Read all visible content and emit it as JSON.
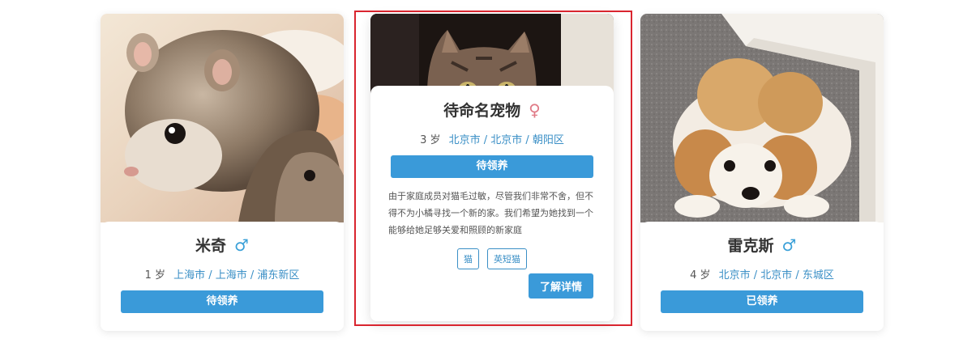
{
  "cards": [
    {
      "name": "米奇",
      "gender_symbol": "♂",
      "age": "1 岁",
      "location": "上海市 / 上海市 / 浦东新区",
      "status": "待领养"
    },
    {
      "name": "待命名宠物",
      "gender_symbol": "♀",
      "age": "3 岁",
      "location": "北京市 / 北京市 / 朝阳区",
      "status": "待领养",
      "description": "由于家庭成员对猫毛过敏，尽管我们非常不舍，但不得不为小橘寻找一个新的家。我们希望为她找到一个能够给她足够关爱和照顾的新家庭",
      "tags": [
        "猫",
        "英短猫"
      ],
      "detail_label": "了解详情"
    },
    {
      "name": "雷克斯",
      "gender_symbol": "♂",
      "age": "4 岁",
      "location": "北京市 / 北京市 / 东城区",
      "status": "已领养"
    }
  ],
  "colors": {
    "accent": "#3a9ad9",
    "highlight_border": "#d9252f",
    "male": "#3aa0d8",
    "female": "#e07a86"
  }
}
